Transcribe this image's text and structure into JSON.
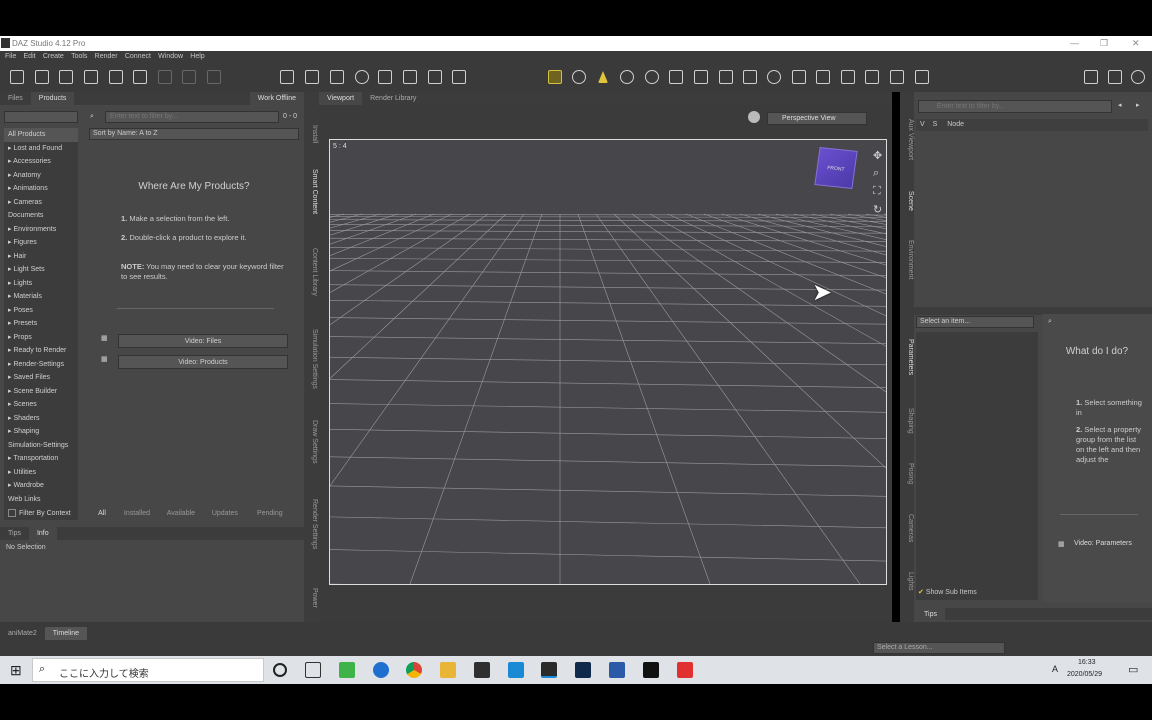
{
  "window": {
    "title": "DAZ Studio 4.12 Pro",
    "controls": [
      "—",
      "❐",
      "✕"
    ]
  },
  "menu": [
    "File",
    "Edit",
    "Create",
    "Tools",
    "Render",
    "Connect",
    "Window",
    "Help"
  ],
  "left": {
    "tabs": [
      "Files",
      "Products"
    ],
    "work_offline": "Work Offline",
    "search_placeholder": "Enter text to filter by...",
    "count": "0 - 0",
    "sort": "Sort by Name: A to Z",
    "categories": [
      "All Products",
      "▸ Lost and Found",
      "▸ Accessories",
      "▸ Anatomy",
      "▸ Animations",
      "▸ Cameras",
      "Documents",
      "▸ Environments",
      "▸ Figures",
      "▸ Hair",
      "▸ Light Sets",
      "▸ Lights",
      "▸ Materials",
      "▸ Poses",
      "▸ Presets",
      "▸ Props",
      "▸ Ready to Render",
      "▸ Render-Settings",
      "▸ Saved Files",
      "▸ Scene Builder",
      "▸ Scenes",
      "▸ Shaders",
      "▸ Shaping",
      "Simulation-Settings",
      "▸ Transportation",
      "▸ Utilities",
      "▸ Wardrobe",
      "Web Links"
    ],
    "filter_context": "Filter By Context",
    "help_title": "Where Are My Products?",
    "step1_num": "1.",
    "step1": "Make a selection from the left.",
    "step2_num": "2.",
    "step2": "Double-click a product to explore it.",
    "note_label": "NOTE:",
    "note": "You may need to clear your keyword filter to see results.",
    "video_files": "Video: Files",
    "video_products": "Video: Products",
    "bottom_tabs": [
      "All",
      "Installed",
      "Available",
      "Updates",
      "Pending"
    ],
    "info_tabs": [
      "Tips",
      "Info"
    ],
    "no_selection": "No Selection"
  },
  "side_tabs": [
    "Install",
    "Smart Content",
    "Content Library",
    "Simulation Settings",
    "Draw Settings",
    "Render Settings",
    "Power"
  ],
  "center": {
    "tabs": [
      "Viewport",
      "Render Library"
    ],
    "view_select": "Perspective View",
    "aspect": "5 : 4",
    "cube_label": "FRONT"
  },
  "right": {
    "search_placeholder": "Enter text to filter by...",
    "col_v": "V",
    "col_s": "S",
    "col_node": "Node",
    "vtabs": [
      "Aux Viewport",
      "Scene",
      "Environment",
      "Parameters",
      "Shaping",
      "Posing",
      "Cameras",
      "Lights"
    ],
    "select_item": "Select an item...",
    "what_title": "What do I do?",
    "s1_num": "1.",
    "s1": "Select something in",
    "s2_num": "2.",
    "s2": "Select a property group from the list on the left and then adjust the",
    "video_params": "Video: Parameters",
    "show_sub": "Show Sub Items",
    "tips": "Tips"
  },
  "bottom": {
    "tabs": [
      "aniMate2",
      "Timeline"
    ],
    "lesson": "Select a Lesson..."
  },
  "taskbar": {
    "search": "ここに入力して検索",
    "time": "16:33",
    "date": "2020/05/29",
    "ime": "A"
  },
  "colors": {
    "viewport_bg": "#47464a",
    "panel": "#474747",
    "accent_yellow": "#e0c43a"
  }
}
